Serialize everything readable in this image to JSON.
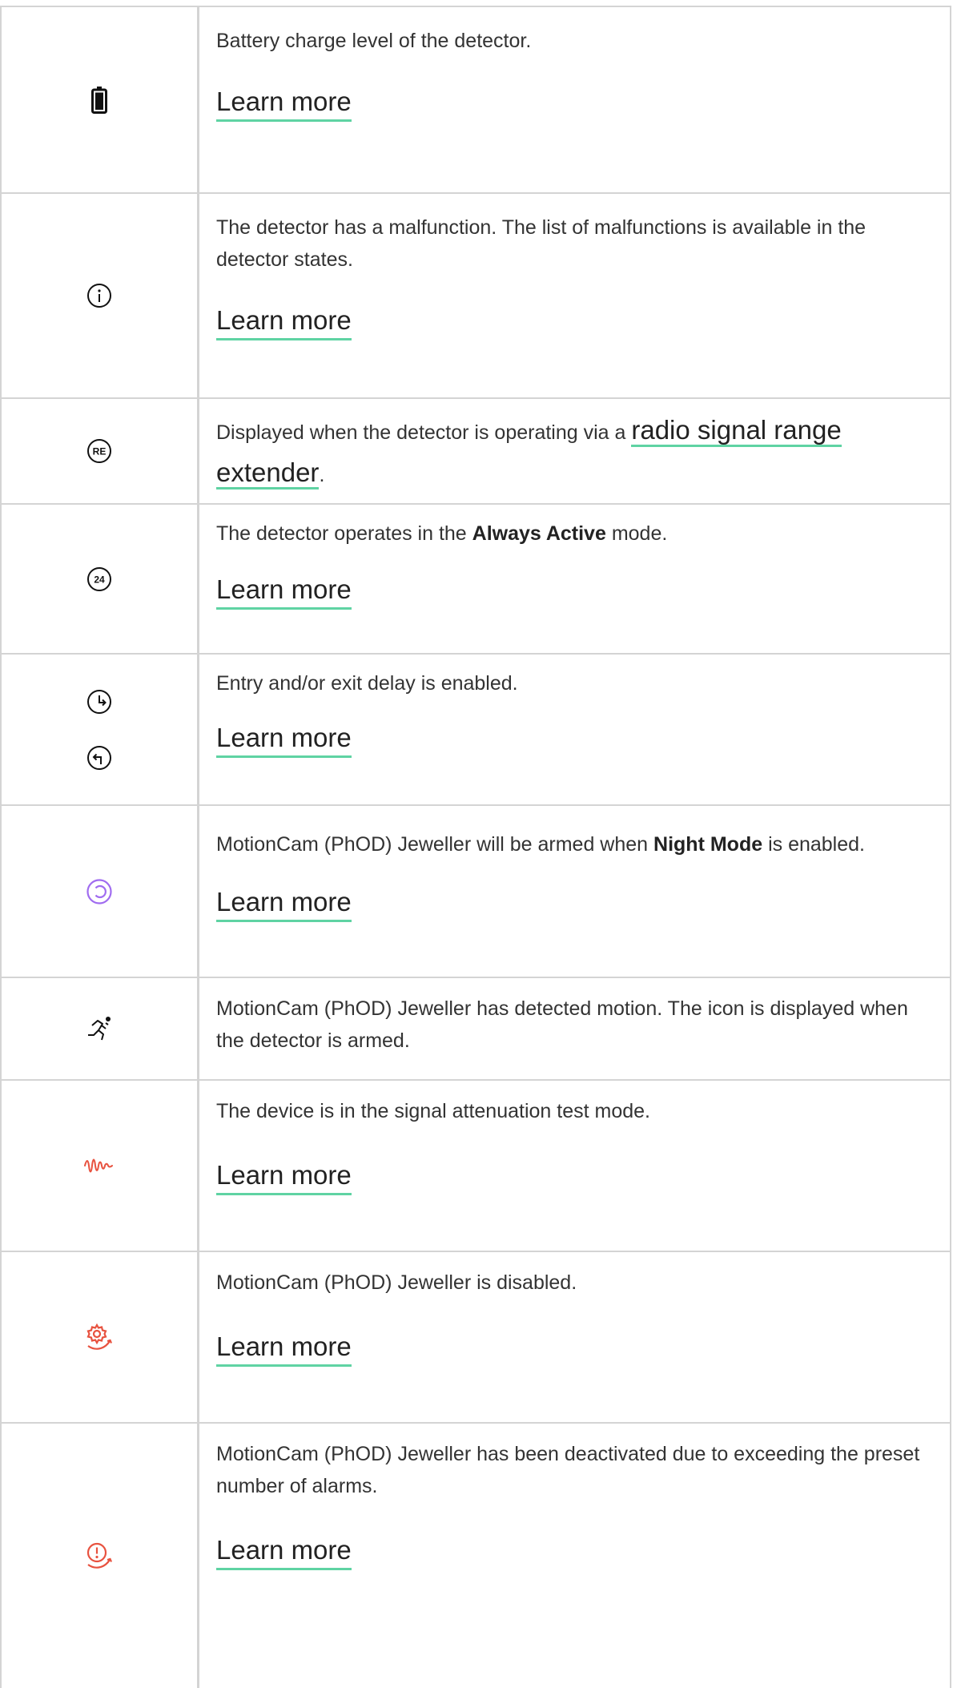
{
  "rows": [
    {
      "icon": "battery-icon",
      "text": "Battery charge level of the detector.",
      "link": "Learn more"
    },
    {
      "icon": "info-icon",
      "text": "The detector has a malfunction. The list of malfunctions is available in the detector states.",
      "link": "Learn more"
    },
    {
      "icon": "range-extender-icon",
      "icon_text": "RE",
      "text_before": "Displayed when the detector is operating via a ",
      "inline_link": "radio signal range extender",
      "text_after": "."
    },
    {
      "icon": "always-active-icon",
      "icon_text": "24",
      "text_before": "The detector operates in the ",
      "bold": "Always Active",
      "text_after": " mode.",
      "link": "Learn more"
    },
    {
      "icon": "entry-exit-delay-icons",
      "text": "Entry and/or exit delay is enabled.",
      "link": "Learn more"
    },
    {
      "icon": "night-mode-icon",
      "text_before": "MotionCam (PhOD) Jeweller will be armed when ",
      "bold": "Night Mode",
      "text_after": " is enabled.",
      "link": "Learn more",
      "color": "#a06cf0"
    },
    {
      "icon": "motion-detected-icon",
      "text": "MotionCam (PhOD) Jeweller has detected motion. The icon is displayed when the detector is armed."
    },
    {
      "icon": "signal-attenuation-icon",
      "text": "The device is in the signal attenuation test mode.",
      "link": "Learn more",
      "color": "#e8523f"
    },
    {
      "icon": "device-disabled-icon",
      "text": "MotionCam (PhOD) Jeweller is disabled.",
      "link": "Learn more",
      "color": "#e8523f"
    },
    {
      "icon": "deactivated-alarms-icon",
      "text": "MotionCam (PhOD) Jeweller has been deactivated due to exceeding the preset number of alarms.",
      "link": "Learn more",
      "color": "#e8523f"
    }
  ]
}
